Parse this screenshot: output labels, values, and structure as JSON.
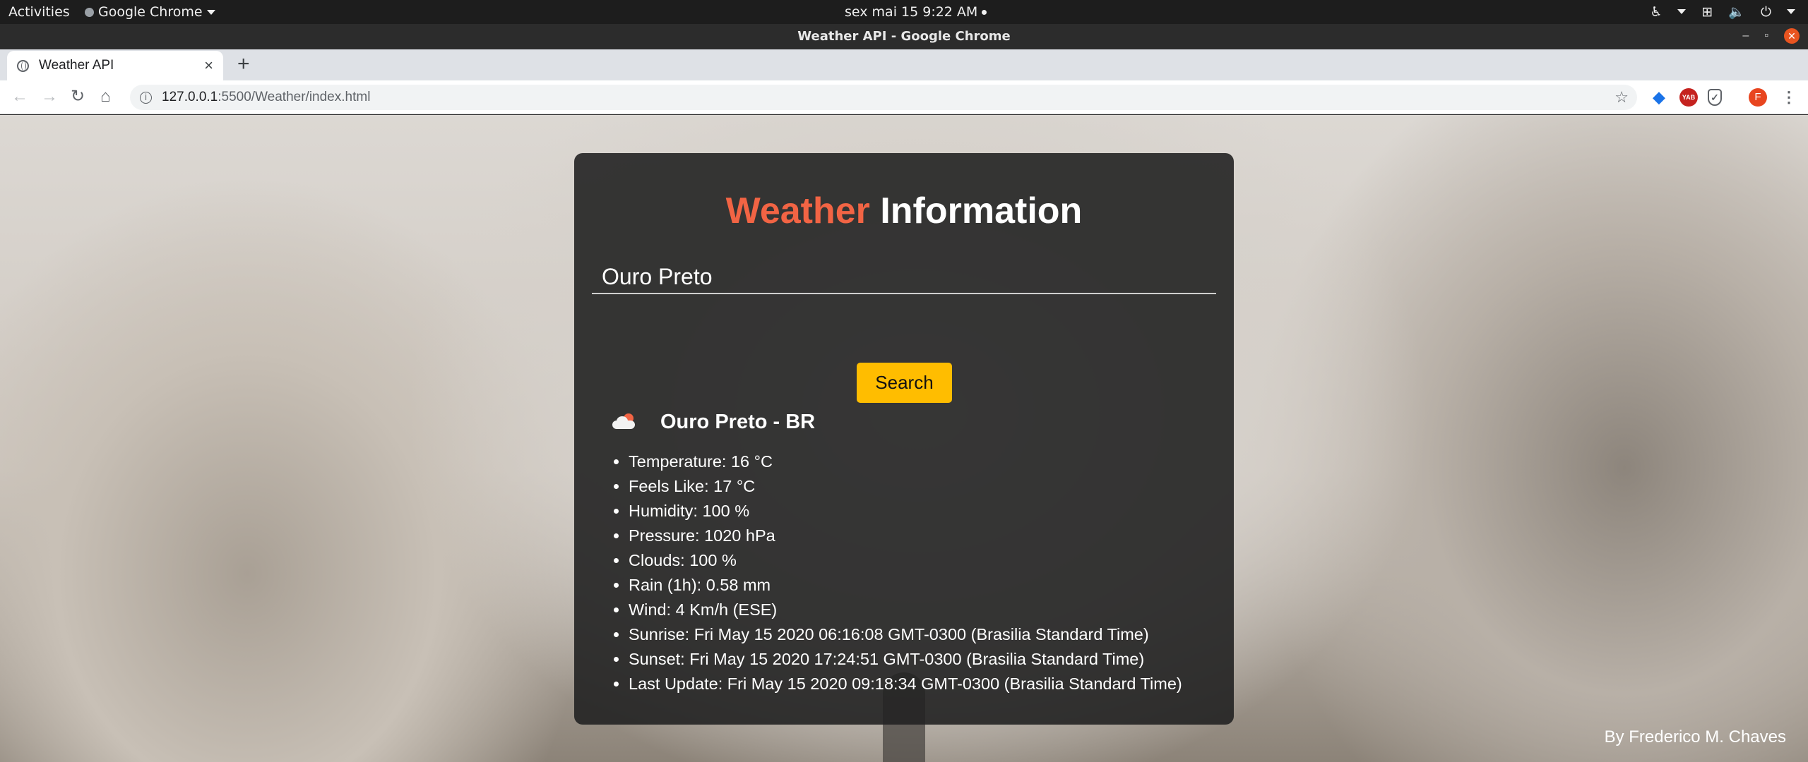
{
  "system_bar": {
    "activities": "Activities",
    "app_name": "Google Chrome",
    "clock": "sex mai 15   9:22 AM"
  },
  "window": {
    "title": "Weather API - Google Chrome"
  },
  "tab": {
    "title": "Weather API",
    "close": "×",
    "new_tab": "+"
  },
  "address_bar": {
    "host": "127.0.0.1",
    "path": ":5500/Weather/index.html"
  },
  "extensions": {
    "yab_label": "YAB",
    "profile_initial": "F"
  },
  "app": {
    "title_accent": "Weather",
    "title_rest": "Information",
    "accent_color": "#f26444",
    "button_color": "#ffbd00",
    "search_value": "Ouro Preto",
    "search_button": "Search",
    "location": "Ouro Preto - BR",
    "weather_icon": "cloud-sun-icon",
    "details": [
      "Temperature: 16 °C",
      "Feels Like: 17 °C",
      "Humidity: 100 %",
      "Pressure: 1020 hPa",
      "Clouds: 100 %",
      "Rain (1h): 0.58 mm",
      "Wind: 4 Km/h (ESE)",
      "Sunrise: Fri May 15 2020 06:16:08 GMT-0300 (Brasilia Standard Time)",
      "Sunset: Fri May 15 2020 17:24:51 GMT-0300 (Brasilia Standard Time)",
      "Last Update: Fri May 15 2020 09:18:34 GMT-0300 (Brasilia Standard Time)"
    ],
    "credit": "By Frederico M. Chaves"
  }
}
